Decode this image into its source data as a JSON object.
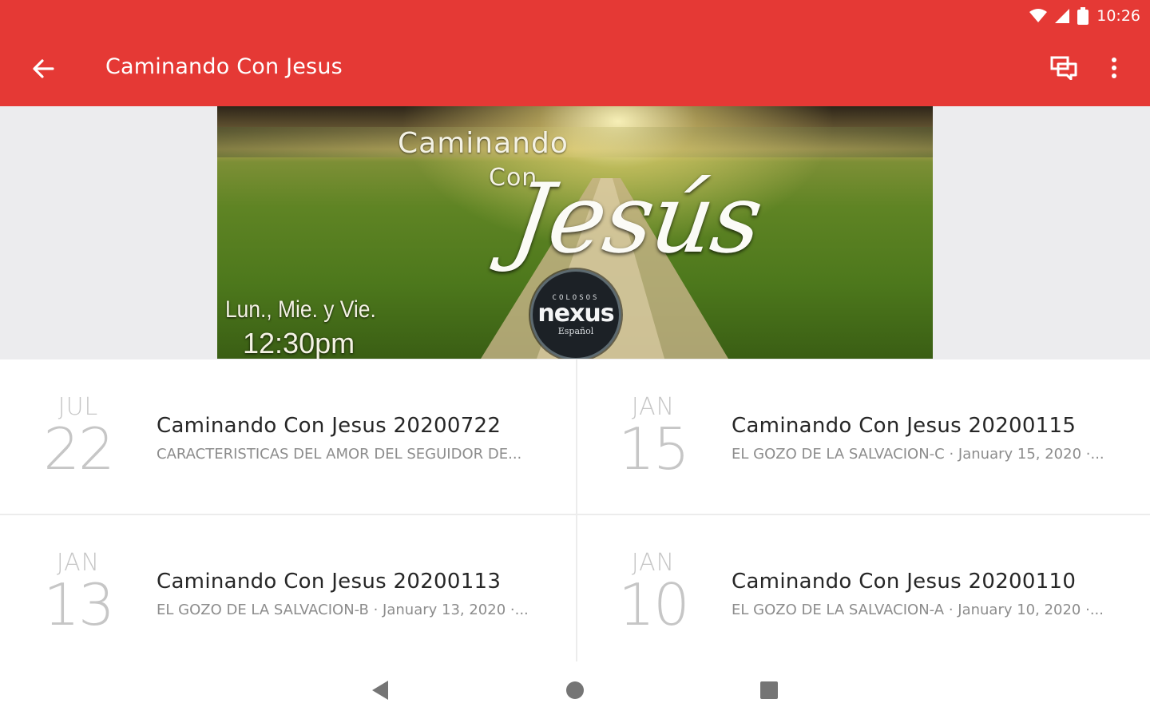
{
  "status_bar": {
    "time": "10:26",
    "icons": [
      "wifi-icon",
      "signal-icon",
      "battery-icon"
    ]
  },
  "toolbar": {
    "title": "Caminando Con Jesus",
    "back_icon": "arrow-left-icon",
    "actions": [
      "chat-icon",
      "more-vert-icon"
    ],
    "color": "#e53935"
  },
  "banner": {
    "line1": "Caminando",
    "line2": "Con",
    "line3": "Jesús",
    "schedule_days": "Lun., Mie. y Vie.",
    "schedule_time": "12:30pm",
    "logo_top": "COLOSOS",
    "logo_main": "nexus",
    "logo_sub": "Español"
  },
  "items": [
    {
      "month": "JUL",
      "day": "22",
      "title": "Caminando Con Jesus 20200722",
      "subtitle": "CARACTERISTICAS DEL AMOR DEL SEGUIDOR DE..."
    },
    {
      "month": "JAN",
      "day": "15",
      "title": "Caminando Con Jesus 20200115",
      "subtitle": "EL GOZO DE LA SALVACION-C · January 15, 2020 ·..."
    },
    {
      "month": "JAN",
      "day": "13",
      "title": "Caminando Con Jesus 20200113",
      "subtitle": "EL GOZO DE LA SALVACION-B · January 13, 2020 ·..."
    },
    {
      "month": "JAN",
      "day": "10",
      "title": "Caminando Con Jesus 20200110",
      "subtitle": "EL GOZO DE LA SALVACION-A · January 10, 2020 ·..."
    }
  ],
  "nav_bar": {
    "buttons": [
      "back-triangle-icon",
      "home-circle-icon",
      "recents-square-icon"
    ]
  }
}
